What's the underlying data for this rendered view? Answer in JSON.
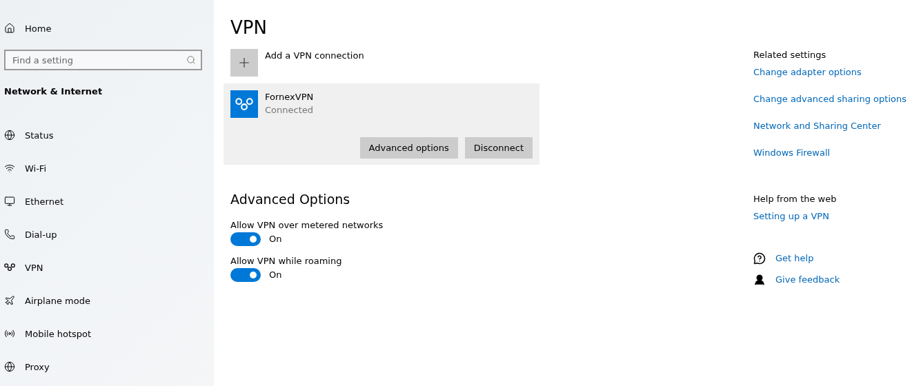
{
  "sidebar": {
    "home": "Home",
    "search": {
      "placeholder": "Find a setting"
    },
    "section": "Network & Internet",
    "items": [
      {
        "kind": "status",
        "label": "Status"
      },
      {
        "kind": "wifi",
        "label": "Wi-Fi"
      },
      {
        "kind": "ethernet",
        "label": "Ethernet"
      },
      {
        "kind": "dialup",
        "label": "Dial-up"
      },
      {
        "kind": "vpn",
        "label": "VPN"
      },
      {
        "kind": "airplane",
        "label": "Airplane mode"
      },
      {
        "kind": "hotspot",
        "label": "Mobile hotspot"
      },
      {
        "kind": "proxy",
        "label": "Proxy"
      }
    ]
  },
  "main": {
    "title": "VPN",
    "add_label": "Add a VPN connection",
    "connection": {
      "name": "FornexVPN",
      "status": "Connected",
      "buttons": [
        "Advanced options",
        "Disconnect"
      ]
    },
    "advanced_title": "Advanced Options",
    "toggles": [
      {
        "label": "Allow VPN over metered networks",
        "on": true,
        "state_text": "On"
      },
      {
        "label": "Allow VPN while roaming",
        "on": true,
        "state_text": "On"
      }
    ]
  },
  "related": {
    "title": "Related settings",
    "links": [
      "Change adapter options",
      "Change advanced sharing options",
      "Network and Sharing Center",
      "Windows Firewall"
    ]
  },
  "help": {
    "title": "Help from the web",
    "links": [
      "Setting up a VPN"
    ]
  },
  "support": [
    {
      "kind": "help",
      "label": "Get help"
    },
    {
      "kind": "feedback",
      "label": "Give feedback"
    }
  ]
}
